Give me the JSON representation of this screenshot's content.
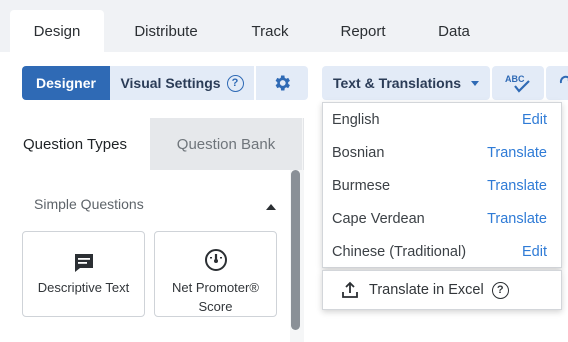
{
  "nav": {
    "tabs": [
      {
        "label": "Design",
        "active": true
      },
      {
        "label": "Distribute",
        "active": false
      },
      {
        "label": "Track",
        "active": false
      },
      {
        "label": "Report",
        "active": false
      },
      {
        "label": "Data",
        "active": false
      }
    ]
  },
  "toolbar": {
    "designer_label": "Designer",
    "visual_settings_label": "Visual Settings",
    "help_glyph": "?",
    "text_translations_label": "Text & Translations",
    "spell_label": "ABC"
  },
  "left_panel": {
    "tabs": [
      "Question Types",
      "Question Bank"
    ],
    "section_title": "Simple Questions",
    "cards": [
      {
        "label": "Descriptive Text",
        "icon": "comment-icon"
      },
      {
        "label_line1": "Net Promoter®",
        "label_line2": "Score",
        "icon": "gauge-icon"
      }
    ]
  },
  "languages": [
    {
      "name": "English",
      "action": "Edit"
    },
    {
      "name": "Bosnian",
      "action": "Translate"
    },
    {
      "name": "Burmese",
      "action": "Translate"
    },
    {
      "name": "Cape Verdean",
      "action": "Translate"
    },
    {
      "name": "Chinese (Traditional)",
      "action": "Edit"
    }
  ],
  "excel": {
    "label": "Translate in Excel",
    "help_glyph": "?"
  },
  "colors": {
    "primary": "#2f6ab5",
    "link": "#2f7bd6",
    "secondary_bg": "#e3ebf7"
  }
}
